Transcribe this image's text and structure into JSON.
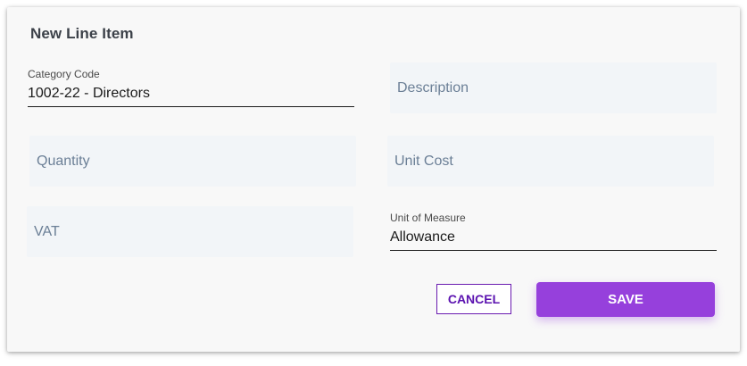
{
  "dialog": {
    "title": "New Line Item",
    "fields": {
      "category_code": {
        "label": "Category Code",
        "value": "1002-22 - Directors"
      },
      "description": {
        "placeholder": "Description"
      },
      "quantity": {
        "placeholder": "Quantity"
      },
      "unit_cost": {
        "placeholder": "Unit Cost"
      },
      "vat": {
        "placeholder": "VAT"
      },
      "unit_of_measure": {
        "label": "Unit of Measure",
        "value": "Allowance"
      }
    },
    "actions": {
      "cancel_label": "CANCEL",
      "save_label": "SAVE"
    }
  },
  "colors": {
    "accent": "#9640dc",
    "cancel_text": "#5b12b0",
    "placeholder_text": "#6b7f96",
    "field_background": "#f2f5f8"
  }
}
